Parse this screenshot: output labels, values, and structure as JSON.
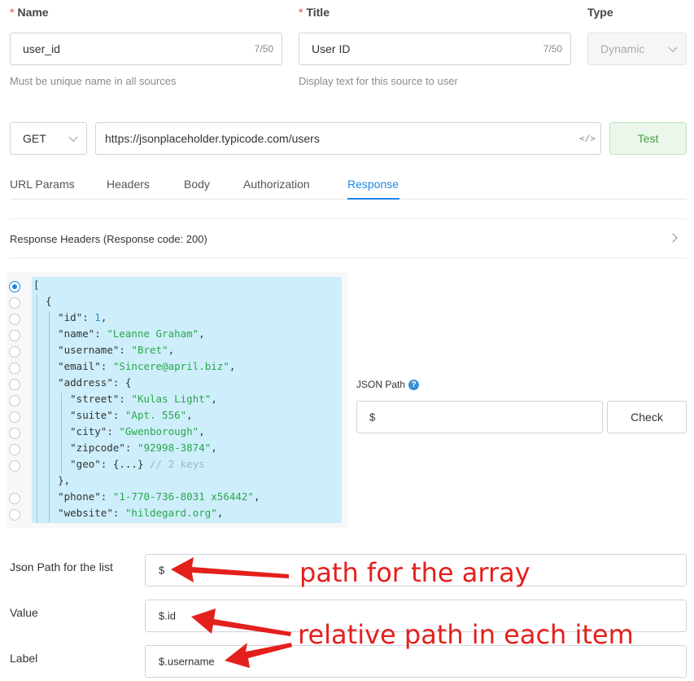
{
  "form": {
    "name": {
      "label": "Name",
      "required_mark": "*",
      "value": "user_id",
      "count": "7/50",
      "help": "Must be unique name in all sources"
    },
    "title": {
      "label": "Title",
      "required_mark": "*",
      "value": "User ID",
      "count": "7/50",
      "help": "Display text for this source to user"
    },
    "type": {
      "label": "Type",
      "value": "Dynamic"
    }
  },
  "request": {
    "method": "GET",
    "url": "https://jsonplaceholder.typicode.com/users",
    "code_toggle": "</>",
    "test_label": "Test"
  },
  "tabs": [
    {
      "label": "URL Params",
      "active": false
    },
    {
      "label": "Headers",
      "active": false
    },
    {
      "label": "Body",
      "active": false
    },
    {
      "label": "Authorization",
      "active": false
    },
    {
      "label": "Response",
      "active": true
    }
  ],
  "response_headers": {
    "label": "Response Headers (Response code: 200)"
  },
  "json_view": {
    "lines": [
      "[",
      "  {",
      "    \"id\": 1,",
      "    \"name\": \"Leanne Graham\",",
      "    \"username\": \"Bret\",",
      "    \"email\": \"Sincere@april.biz\",",
      "    \"address\": {",
      "      \"street\": \"Kulas Light\",",
      "      \"suite\": \"Apt. 556\",",
      "      \"city\": \"Gwenborough\",",
      "      \"zipcode\": \"92998-3874\",",
      "      \"geo\": {...} // 2 keys",
      "    },",
      "    \"phone\": \"1-770-736-8031 x56442\",",
      "    \"website\": \"hildegard.org\","
    ]
  },
  "json_path": {
    "label": "JSON Path",
    "help_icon": "?",
    "value": "$",
    "check_label": "Check"
  },
  "mapping": {
    "list_path": {
      "label": "Json Path for the list",
      "value": "$"
    },
    "value": {
      "label": "Value",
      "value": "$.id"
    },
    "label": {
      "label": "Label",
      "value": "$.username"
    }
  },
  "annotations": {
    "array": "path for the array",
    "relative": "relative path in each item"
  },
  "colors": {
    "accent": "#1e88e5",
    "annotation": "#e4201c",
    "json_bg": "#cdeefa",
    "string": "#2aa84a",
    "number": "#2f8bd0"
  }
}
